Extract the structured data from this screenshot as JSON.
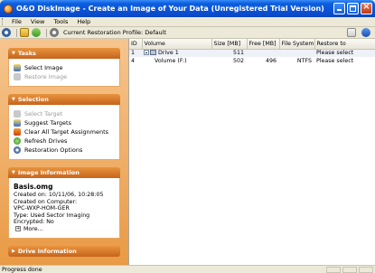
{
  "window": {
    "title": "O&O DiskImage - Create an Image of Your Data (Unregistered Trial Version)"
  },
  "menu": [
    "File",
    "View",
    "Tools",
    "Help"
  ],
  "toolbar": {
    "restoration_profile": "Current Restoration Profile: Default"
  },
  "tasks": {
    "header": "Tasks",
    "items": [
      {
        "label": "Select Image",
        "enabled": true
      },
      {
        "label": "Restore Image",
        "enabled": false
      }
    ]
  },
  "selection": {
    "header": "Selection",
    "items": [
      {
        "label": "Select Target",
        "enabled": false
      },
      {
        "label": "Suggest Targets",
        "enabled": true
      },
      {
        "label": "Clear All Target Assignments",
        "enabled": true
      },
      {
        "label": "Refresh Drives",
        "enabled": true
      },
      {
        "label": "Restoration Options",
        "enabled": true
      }
    ]
  },
  "image_info": {
    "header": "Image Information",
    "name": "Basis.omg",
    "created_on": "Created on: 10/11/06, 10:28:05",
    "computer_label": "Created on Computer:",
    "computer": "VPC-WXP-HOM-GER",
    "type": "Type: Used Sector Imaging",
    "encrypted": "Encrypted: No",
    "more": "More..."
  },
  "drive_info": {
    "header": "Drive Information"
  },
  "table": {
    "columns": [
      "ID",
      "Volume",
      "Size [MB]",
      "Free [MB]",
      "File System",
      "Restore to"
    ],
    "rows": [
      {
        "id": "1",
        "volume": "Drive 1",
        "size": "511",
        "free": "",
        "fs": "",
        "restore": "Please select"
      },
      {
        "id": "4",
        "volume": "Volume (F:)",
        "size": "502",
        "free": "496",
        "fs": "NTFS",
        "restore": "Please select"
      }
    ]
  },
  "status": {
    "text": "Progress done"
  }
}
